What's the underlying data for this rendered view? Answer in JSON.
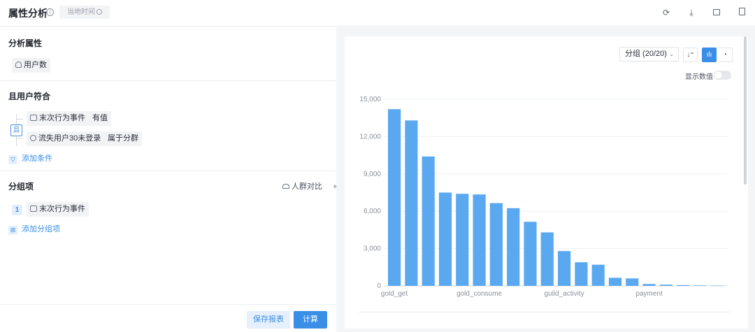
{
  "header": {
    "title": "属性分析",
    "timezone_badge": "当地时间"
  },
  "left": {
    "attribute_section": {
      "title": "分析属性",
      "metric_chip": "用户数"
    },
    "condition_section": {
      "title": "且用户符合",
      "and_label": "且",
      "conditions": [
        {
          "field": "末次行为事件",
          "operator": "有值"
        },
        {
          "field": "流失用户30未登录",
          "operator": "属于分群"
        }
      ],
      "add_condition": "添加条件"
    },
    "group_section": {
      "title": "分组项",
      "compare_label": "人群对比",
      "items": [
        {
          "index": "1",
          "label": "末次行为事件"
        }
      ],
      "add_group": "添加分组项"
    },
    "footer": {
      "save_label": "保存报表",
      "calc_label": "计算"
    }
  },
  "right": {
    "group_select": "分组 (20/20)",
    "show_values_label": "显示数值",
    "show_values_on": false,
    "active_view": "bar"
  },
  "chart_data": {
    "type": "bar",
    "xlabel": "",
    "ylabel": "",
    "ylim": [
      0,
      15000
    ],
    "y_ticks": [
      "0",
      "3,000",
      "6,000",
      "9,000",
      "12,000",
      "15,000"
    ],
    "x_tick_labels": [
      {
        "index": 0,
        "label": "gold_get"
      },
      {
        "index": 5,
        "label": "gold_consume"
      },
      {
        "index": 10,
        "label": "guild_activity"
      },
      {
        "index": 15,
        "label": "payment"
      }
    ],
    "grid": true,
    "color": "#5aa9f0",
    "values": [
      14200,
      13300,
      10400,
      7500,
      7400,
      7350,
      6650,
      6250,
      5150,
      4300,
      2800,
      1900,
      1700,
      650,
      600,
      150,
      100,
      60,
      40,
      20
    ]
  }
}
